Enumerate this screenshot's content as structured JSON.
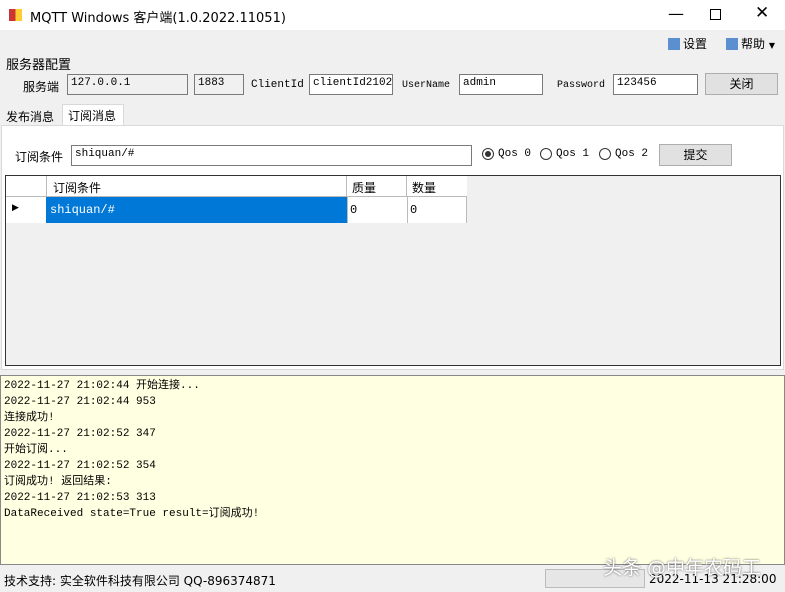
{
  "window": {
    "title": "MQTT Windows 客户端(1.0.2022.11051)"
  },
  "toolbar": {
    "settings": "设置",
    "help": "帮助"
  },
  "server": {
    "group": "服务器配置",
    "host_label": "服务端",
    "host": "127.0.0.1",
    "port": "1883",
    "client_label": "ClientId",
    "client": "clientId21024",
    "user_label": "UserName",
    "user": "admin",
    "pass_label": "Password",
    "pass": "123456",
    "close": "关闭"
  },
  "tabs": [
    "发布消息",
    "订阅消息"
  ],
  "subscribe": {
    "label": "订阅条件",
    "value": "shiquan/#",
    "qos": [
      "Qos 0",
      "Qos 1",
      "Qos 2"
    ],
    "submit": "提交"
  },
  "grid": {
    "headers": [
      "订阅条件",
      "质量",
      "数量"
    ],
    "rows": [
      [
        "shiquan/#",
        "0",
        "0"
      ]
    ]
  },
  "log": [
    "2022-11-27 21:02:44 开始连接...",
    "2022-11-27 21:02:44 953",
    "连接成功!",
    "2022-11-27 21:02:52 347",
    "开始订阅...",
    "2022-11-27 21:02:52 354",
    "订阅成功! 返回结果:",
    "2022-11-27 21:02:53 313",
    "DataReceived state=True result=订阅成功!"
  ],
  "status": {
    "support": "技术支持: 实全软件科技有限公司 QQ-896374871",
    "time": "2022-11-13 21:28:00"
  },
  "watermark": "头条 @中年农码工"
}
